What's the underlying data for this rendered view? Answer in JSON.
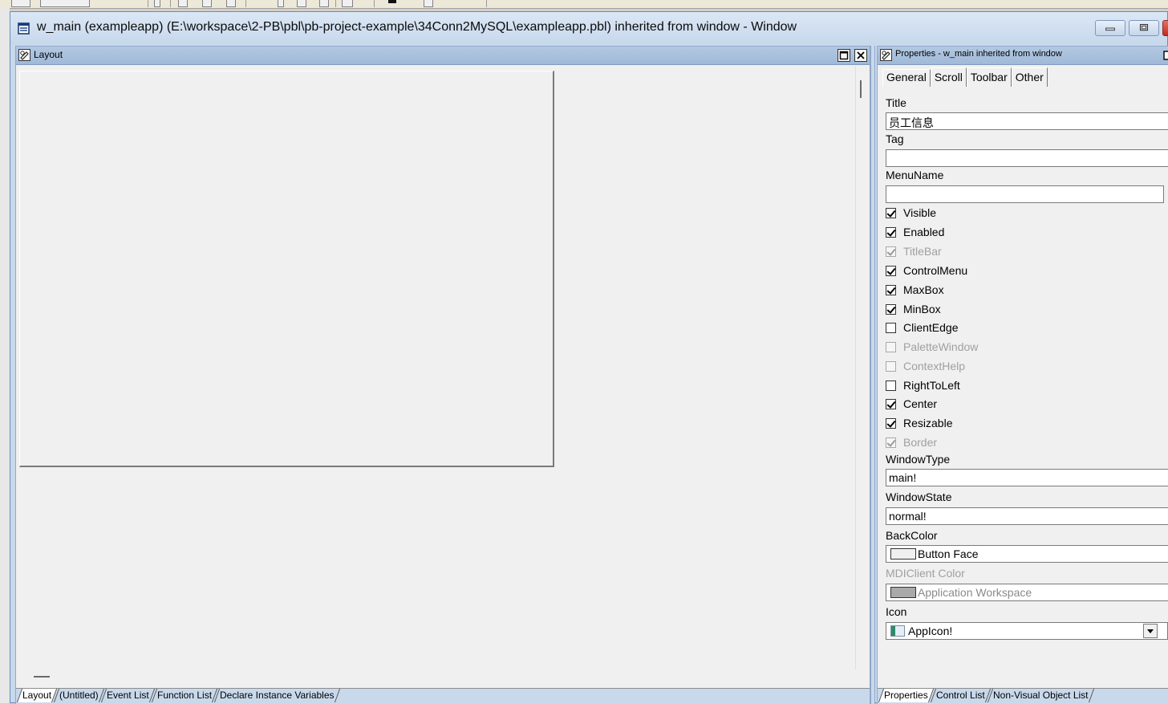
{
  "window": {
    "title": "w_main (exampleapp) (E:\\workspace\\2-PB\\pbl\\pb-project-example\\34Conn2MySQL\\exampleapp.pbl) inherited from window - Window",
    "icon": "window-app-icon"
  },
  "layout_pane": {
    "title": "Layout",
    "icon": "layout-pane-icon",
    "tabs": [
      "Layout",
      "(Untitled)",
      "Event List",
      "Function List",
      "Declare Instance Variables"
    ],
    "active_tab": "Layout"
  },
  "properties_pane": {
    "title": "Properties - w_main inherited from window",
    "icon": "properties-pane-icon",
    "tabs": [
      "General",
      "Scroll",
      "Toolbar",
      "Other"
    ],
    "active_tab": "General",
    "labels": {
      "title": "Title",
      "tag": "Tag",
      "menuname": "MenuName",
      "windowtype": "WindowType",
      "windowstate": "WindowState",
      "backcolor": "BackColor",
      "mdiclientcolor": "MDIClient Color",
      "icon": "Icon"
    },
    "values": {
      "title": "员工信息",
      "tag": "",
      "menuname": "",
      "windowtype": "main!",
      "windowstate": "normal!",
      "backcolor": "Button Face",
      "mdiclientcolor": "Application Workspace",
      "icon": "AppIcon!"
    },
    "swatch_colors": {
      "backcolor": "#f0f0f0",
      "mdiclientcolor": "#a9a9a9"
    },
    "checkboxes": [
      {
        "label": "Visible",
        "checked": true,
        "enabled": true
      },
      {
        "label": "Enabled",
        "checked": true,
        "enabled": true
      },
      {
        "label": "TitleBar",
        "checked": true,
        "enabled": false
      },
      {
        "label": "ControlMenu",
        "checked": true,
        "enabled": true
      },
      {
        "label": "MaxBox",
        "checked": true,
        "enabled": true
      },
      {
        "label": "MinBox",
        "checked": true,
        "enabled": true
      },
      {
        "label": "ClientEdge",
        "checked": false,
        "enabled": true
      },
      {
        "label": "PaletteWindow",
        "checked": false,
        "enabled": false
      },
      {
        "label": "ContextHelp",
        "checked": false,
        "enabled": false
      },
      {
        "label": "RightToLeft",
        "checked": false,
        "enabled": true
      },
      {
        "label": "Center",
        "checked": true,
        "enabled": true
      },
      {
        "label": "Resizable",
        "checked": true,
        "enabled": true
      },
      {
        "label": "Border",
        "checked": true,
        "enabled": false
      }
    ],
    "bottom_tabs": [
      "Properties",
      "Control List",
      "Non-Visual Object List"
    ],
    "active_bottom_tab": "Properties"
  }
}
